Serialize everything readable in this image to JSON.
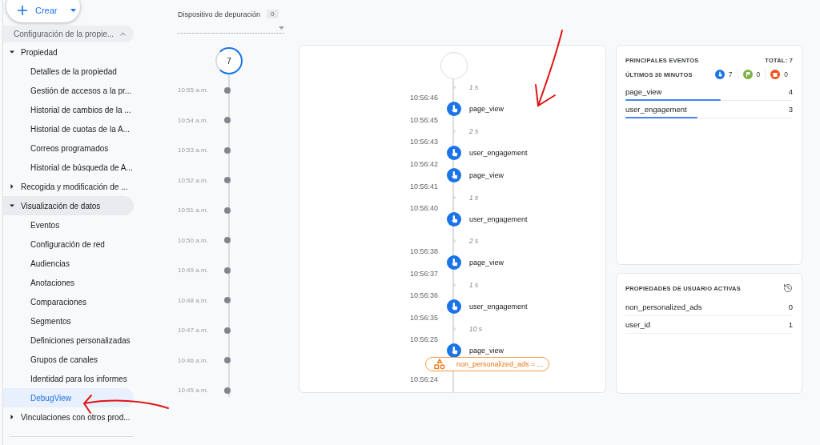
{
  "sidebar": {
    "create_button": {
      "label": "Crear"
    },
    "section": {
      "label": "Configuración de la propie...",
      "expanded": true
    },
    "items": [
      {
        "label": "Propiedad",
        "expanded": true,
        "children": [
          {
            "label": "Detalles de la propiedad",
            "selected": false
          },
          {
            "label": "Gestión de accesos a la pr...",
            "selected": false
          },
          {
            "label": "Historial de cambios de la ...",
            "selected": false
          },
          {
            "label": "Historial de cuotas de la A...",
            "selected": false
          },
          {
            "label": "Correos programados",
            "selected": false
          },
          {
            "label": "Historial de búsqueda de A...",
            "selected": false
          }
        ]
      },
      {
        "label": "Recogida y modificación de ...",
        "expanded": false
      },
      {
        "label": "Visualización de datos",
        "expanded": true,
        "children": [
          {
            "label": "Eventos",
            "selected": false
          },
          {
            "label": "Configuración de red",
            "selected": false
          },
          {
            "label": "Audiencias",
            "selected": false
          },
          {
            "label": "Anotaciones",
            "selected": false
          },
          {
            "label": "Comparaciones",
            "selected": false
          },
          {
            "label": "Segmentos",
            "selected": false
          },
          {
            "label": "Definiciones personalizadas",
            "selected": false
          },
          {
            "label": "Grupos de canales",
            "selected": false
          },
          {
            "label": "Identidad para los informes",
            "selected": false
          },
          {
            "label": "DebugView",
            "selected": true
          }
        ]
      },
      {
        "label": "Vinculaciones con otros prod...",
        "expanded": false
      }
    ]
  },
  "debug_device": {
    "label": "Dispositivo de depuración",
    "count": "0"
  },
  "minutes": {
    "count": "7",
    "times": [
      "10:55 a.m.",
      "10:54 a.m.",
      "10:53 a.m.",
      "10:52 a.m.",
      "10:51 a.m.",
      "10:50 a.m.",
      "10:49 a.m.",
      "10:48 a.m.",
      "10:47 a.m.",
      "10:46 a.m.",
      "10:45 a.m."
    ]
  },
  "timeline": [
    {
      "kind": "gap",
      "text": "1 s"
    },
    {
      "kind": "time",
      "text": "10:56:46"
    },
    {
      "kind": "event",
      "text": "page_view"
    },
    {
      "kind": "time",
      "text": "10:56:45"
    },
    {
      "kind": "gap",
      "text": "2 s"
    },
    {
      "kind": "time",
      "text": "10:56:43"
    },
    {
      "kind": "event",
      "text": "user_engagement"
    },
    {
      "kind": "time",
      "text": "10:56:42"
    },
    {
      "kind": "event",
      "text": "page_view"
    },
    {
      "kind": "time",
      "text": "10:56:41"
    },
    {
      "kind": "gap",
      "text": "1 s"
    },
    {
      "kind": "time",
      "text": "10:56:40"
    },
    {
      "kind": "event",
      "text": "user_engagement"
    },
    {
      "kind": "gap",
      "text": "2 s"
    },
    {
      "kind": "time",
      "text": "10:56:38"
    },
    {
      "kind": "event",
      "text": "page_view"
    },
    {
      "kind": "time",
      "text": "10:56:37"
    },
    {
      "kind": "gap",
      "text": "1 s"
    },
    {
      "kind": "time",
      "text": "10:56:36"
    },
    {
      "kind": "event",
      "text": "user_engagement"
    },
    {
      "kind": "time",
      "text": "10:56:35"
    },
    {
      "kind": "gap",
      "text": "10 s"
    },
    {
      "kind": "time",
      "text": "10:56:25"
    },
    {
      "kind": "event",
      "text": "page_view"
    },
    {
      "kind": "parameter",
      "text": "non_personalized_ads = ..."
    },
    {
      "kind": "time",
      "text": "10:56:24"
    }
  ],
  "top_events": {
    "title": "PRINCIPALES EVENTOS",
    "total": "TOTAL: 7",
    "period": "ÚLTIMOS 30 MINUTOS",
    "counters": [
      {
        "kind": "event",
        "count": "7",
        "color": "#1a73e8"
      },
      {
        "kind": "conversion",
        "count": "0",
        "color": "#7cb342"
      },
      {
        "kind": "error",
        "count": "0",
        "color": "#f4511e"
      }
    ],
    "rows": [
      {
        "name": "page_view",
        "count": "4",
        "level": 0.57
      },
      {
        "name": "user_engagement",
        "count": "3",
        "level": 0.43
      }
    ]
  },
  "user_properties": {
    "title": "PROPIEDADES DE USUARIO ACTIVAS",
    "rows": [
      {
        "name": "non_personalized_ads",
        "value": "0"
      },
      {
        "name": "user_id",
        "value": "1"
      }
    ]
  }
}
